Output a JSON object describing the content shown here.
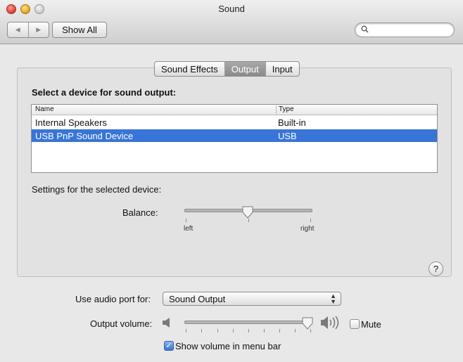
{
  "window": {
    "title": "Sound"
  },
  "toolbar": {
    "back_label": "◀",
    "forward_label": "▶",
    "show_all_label": "Show All",
    "search_placeholder": ""
  },
  "tabs": [
    {
      "label": "Sound Effects",
      "active": false
    },
    {
      "label": "Output",
      "active": true
    },
    {
      "label": "Input",
      "active": false
    }
  ],
  "output": {
    "select_label": "Select a device for sound output:",
    "columns": [
      "Name",
      "Type"
    ],
    "devices": [
      {
        "name": "Internal Speakers",
        "type": "Built-in",
        "selected": false
      },
      {
        "name": "USB PnP Sound Device",
        "type": "USB",
        "selected": true
      }
    ],
    "settings_label": "Settings for the selected device:",
    "balance_label": "Balance:",
    "balance_left": "left",
    "balance_right": "right",
    "balance_value": 0.5
  },
  "help_label": "?",
  "audio_port": {
    "label": "Use audio port for:",
    "value": "Sound Output"
  },
  "volume": {
    "label": "Output volume:",
    "value": 0.97,
    "mute_label": "Mute",
    "mute_checked": false
  },
  "menubar": {
    "label": "Show volume in menu bar",
    "checked": true
  },
  "colors": {
    "selection": "#3875d7",
    "active_tab": "#8a8a8a"
  }
}
